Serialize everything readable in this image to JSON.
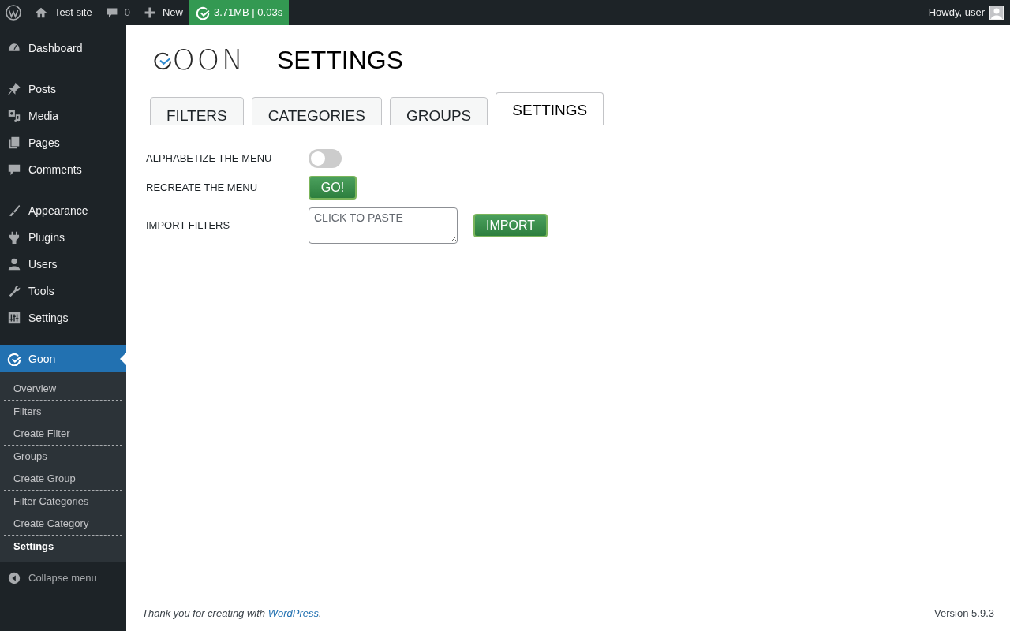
{
  "admin_bar": {
    "site": "Test site",
    "comments": "0",
    "new": "New",
    "stats": "3.71MB | 0.03s",
    "greeting": "Howdy, user"
  },
  "sidebar": {
    "sections": [
      [
        {
          "label": "Dashboard",
          "selected": false
        }
      ],
      [
        {
          "label": "Posts",
          "selected": false
        },
        {
          "label": "Media",
          "selected": false
        },
        {
          "label": "Pages",
          "selected": false
        },
        {
          "label": "Comments",
          "selected": false
        }
      ],
      [
        {
          "label": "Appearance",
          "selected": false
        },
        {
          "label": "Plugins",
          "selected": false
        },
        {
          "label": "Users",
          "selected": false
        },
        {
          "label": "Tools",
          "selected": false
        },
        {
          "label": "Settings",
          "selected": false
        }
      ],
      [
        {
          "label": "Goon",
          "selected": true
        }
      ]
    ],
    "submenu": [
      [
        {
          "label": "Overview",
          "selected": false
        }
      ],
      [
        {
          "label": "Filters",
          "selected": false
        },
        {
          "label": "Create Filter",
          "selected": false
        }
      ],
      [
        {
          "label": "Groups",
          "selected": false
        },
        {
          "label": "Create Group",
          "selected": false
        }
      ],
      [
        {
          "label": "Filter Categories",
          "selected": false
        },
        {
          "label": "Create Category",
          "selected": false
        }
      ],
      [
        {
          "label": "Settings",
          "selected": true
        }
      ]
    ],
    "collapse": "Collapse menu"
  },
  "header": {
    "logo": "OON",
    "title": "SETTINGS"
  },
  "tabs": [
    {
      "label": "FILTERS",
      "selected": false
    },
    {
      "label": "CATEGORIES",
      "selected": false
    },
    {
      "label": "GROUPS",
      "selected": false
    },
    {
      "label": "SETTINGS",
      "selected": true
    }
  ],
  "settings": {
    "alphabetize": {
      "label": "ALPHABETIZE THE MENU",
      "on": false
    },
    "recreate": {
      "label": "RECREATE THE MENU",
      "button": "GO!"
    },
    "import": {
      "label": "IMPORT FILTERS",
      "placeholder": "CLICK TO PASTE",
      "button": "IMPORT"
    }
  },
  "footer": {
    "thanks_before": "Thank you for creating with ",
    "link": "WordPress",
    "thanks_after": ".",
    "version": "Version 5.9.3"
  }
}
